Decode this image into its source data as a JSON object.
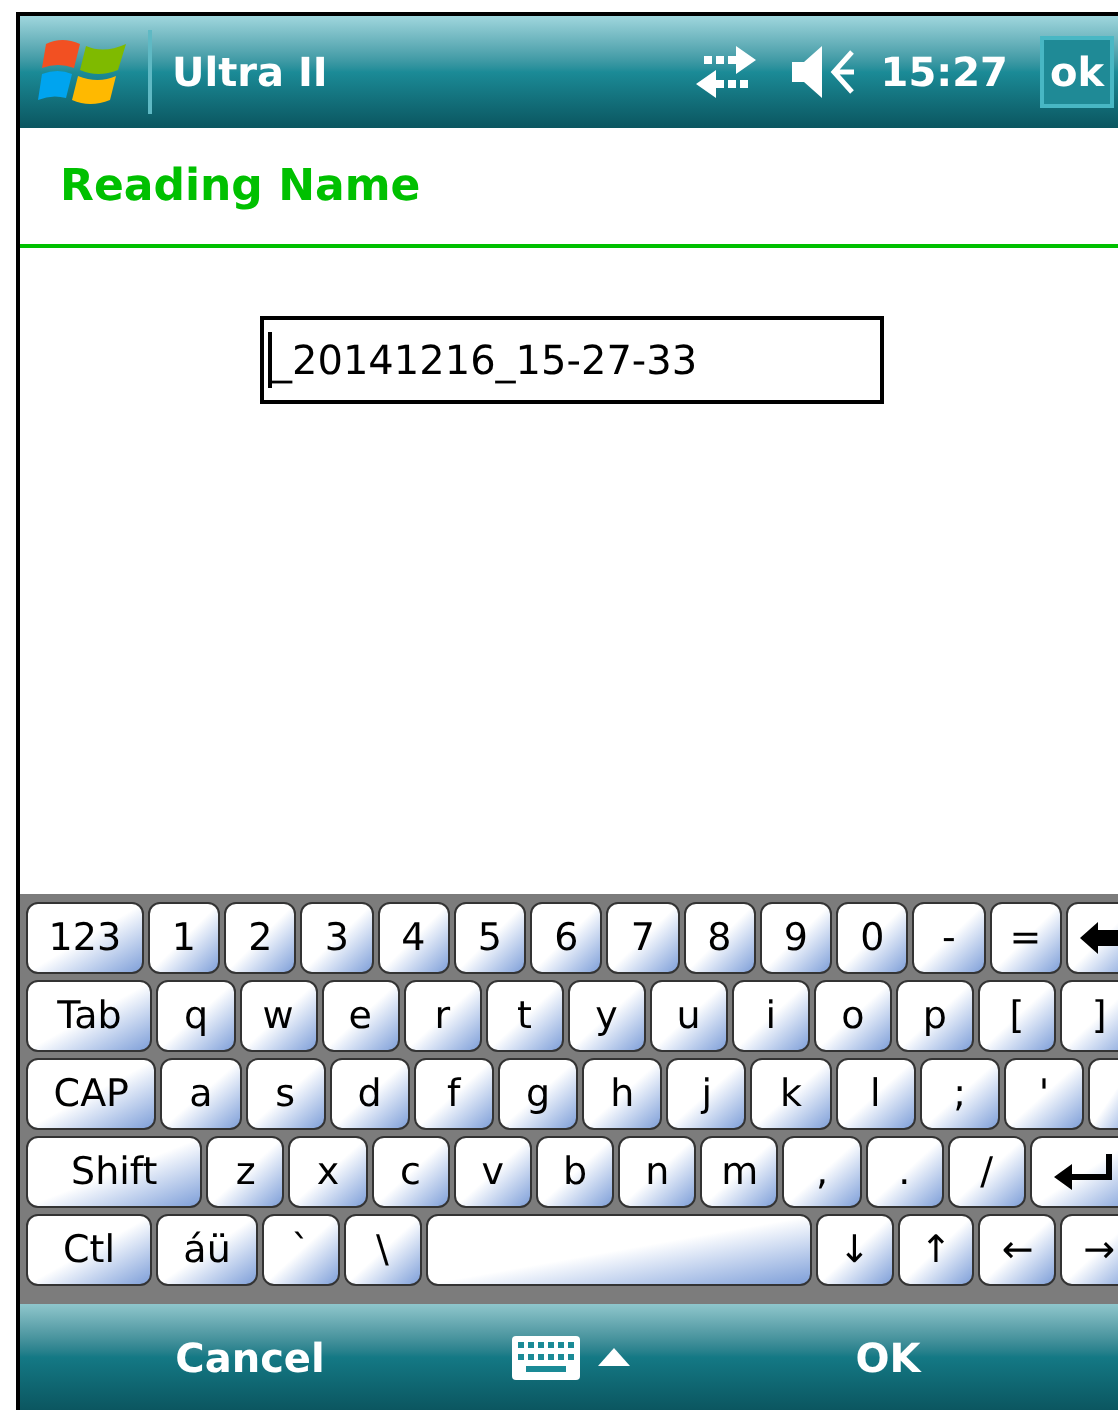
{
  "status_bar": {
    "title": "Ultra II",
    "time": "15:27",
    "ok_button": "ok"
  },
  "header": {
    "title": "Reading Name"
  },
  "name_field": {
    "value": "_20141216_15-27-33"
  },
  "keyboard": {
    "rows": [
      {
        "keys": [
          {
            "kind": "char",
            "label": "123"
          },
          {
            "kind": "char",
            "label": "1"
          },
          {
            "kind": "char",
            "label": "2"
          },
          {
            "kind": "char",
            "label": "3"
          },
          {
            "kind": "char",
            "label": "4"
          },
          {
            "kind": "char",
            "label": "5"
          },
          {
            "kind": "char",
            "label": "6"
          },
          {
            "kind": "char",
            "label": "7"
          },
          {
            "kind": "char",
            "label": "8"
          },
          {
            "kind": "char",
            "label": "9"
          },
          {
            "kind": "char",
            "label": "0"
          },
          {
            "kind": "char",
            "label": "-"
          },
          {
            "kind": "char",
            "label": "="
          },
          {
            "kind": "backspace"
          }
        ]
      },
      {
        "keys": [
          {
            "kind": "char",
            "label": "Tab"
          },
          {
            "kind": "char",
            "label": "q"
          },
          {
            "kind": "char",
            "label": "w"
          },
          {
            "kind": "char",
            "label": "e"
          },
          {
            "kind": "char",
            "label": "r"
          },
          {
            "kind": "char",
            "label": "t"
          },
          {
            "kind": "char",
            "label": "y"
          },
          {
            "kind": "char",
            "label": "u"
          },
          {
            "kind": "char",
            "label": "i"
          },
          {
            "kind": "char",
            "label": "o"
          },
          {
            "kind": "char",
            "label": "p"
          },
          {
            "kind": "char",
            "label": "["
          },
          {
            "kind": "char",
            "label": "]"
          }
        ]
      },
      {
        "keys": [
          {
            "kind": "char",
            "label": "CAP"
          },
          {
            "kind": "char",
            "label": "a"
          },
          {
            "kind": "char",
            "label": "s"
          },
          {
            "kind": "char",
            "label": "d"
          },
          {
            "kind": "char",
            "label": "f"
          },
          {
            "kind": "char",
            "label": "g"
          },
          {
            "kind": "char",
            "label": "h"
          },
          {
            "kind": "char",
            "label": "j"
          },
          {
            "kind": "char",
            "label": "k"
          },
          {
            "kind": "char",
            "label": "l"
          },
          {
            "kind": "char",
            "label": ";"
          },
          {
            "kind": "char",
            "label": "'"
          },
          {
            "kind": "enter-top"
          }
        ]
      },
      {
        "keys": [
          {
            "kind": "char",
            "label": "Shift"
          },
          {
            "kind": "char",
            "label": "z"
          },
          {
            "kind": "char",
            "label": "x"
          },
          {
            "kind": "char",
            "label": "c"
          },
          {
            "kind": "char",
            "label": "v"
          },
          {
            "kind": "char",
            "label": "b"
          },
          {
            "kind": "char",
            "label": "n"
          },
          {
            "kind": "char",
            "label": "m"
          },
          {
            "kind": "char",
            "label": ","
          },
          {
            "kind": "char",
            "label": "."
          },
          {
            "kind": "char",
            "label": "/"
          },
          {
            "kind": "enter"
          }
        ]
      },
      {
        "keys": [
          {
            "kind": "char",
            "label": "Ctl"
          },
          {
            "kind": "char",
            "label": "áü"
          },
          {
            "kind": "char",
            "label": "`"
          },
          {
            "kind": "char",
            "label": "\\"
          },
          {
            "kind": "space"
          },
          {
            "kind": "char",
            "label": "↓"
          },
          {
            "kind": "char",
            "label": "↑"
          },
          {
            "kind": "char",
            "label": "←"
          },
          {
            "kind": "char",
            "label": "→"
          }
        ]
      }
    ]
  },
  "menu_bar": {
    "left": "Cancel",
    "right": "OK"
  }
}
